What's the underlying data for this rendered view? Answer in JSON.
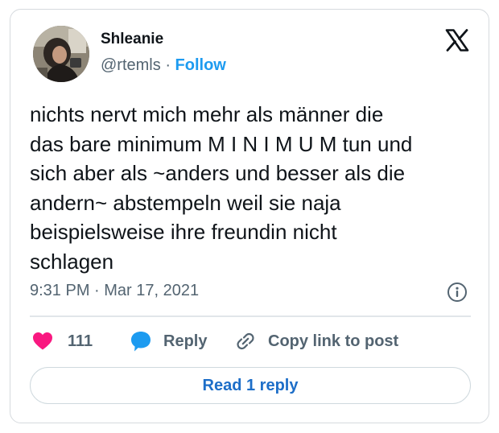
{
  "tweet": {
    "author": {
      "display_name": "Shleanie",
      "handle": "@rtemls",
      "separator": "·",
      "follow_label": "Follow"
    },
    "text": "nichts nervt mich mehr als männer die\ndas bare minimum M I N I M U M tun und\nsich aber als ~anders und besser als die\nandern~ abstempeln weil sie naja\nbeispielsweise ihre freundin nicht\nschlagen",
    "timestamp": "9:31 PM · Mar 17, 2021",
    "actions": {
      "like_count": "111",
      "reply_label": "Reply",
      "copy_link_label": "Copy link to post"
    },
    "read_replies_label": "Read 1 reply"
  },
  "icons": {
    "brand": "x-logo-icon",
    "info": "info-icon",
    "like": "heart-icon",
    "reply": "speech-bubble-icon",
    "copy": "link-icon"
  },
  "colors": {
    "heart": "#f91880",
    "reply_bubble": "#1d9bf0",
    "follow": "#1d9bf0",
    "read_reply_text": "#1d6ec8",
    "text_primary": "#0f1419",
    "text_secondary": "#536471",
    "border": "#d6dade"
  }
}
